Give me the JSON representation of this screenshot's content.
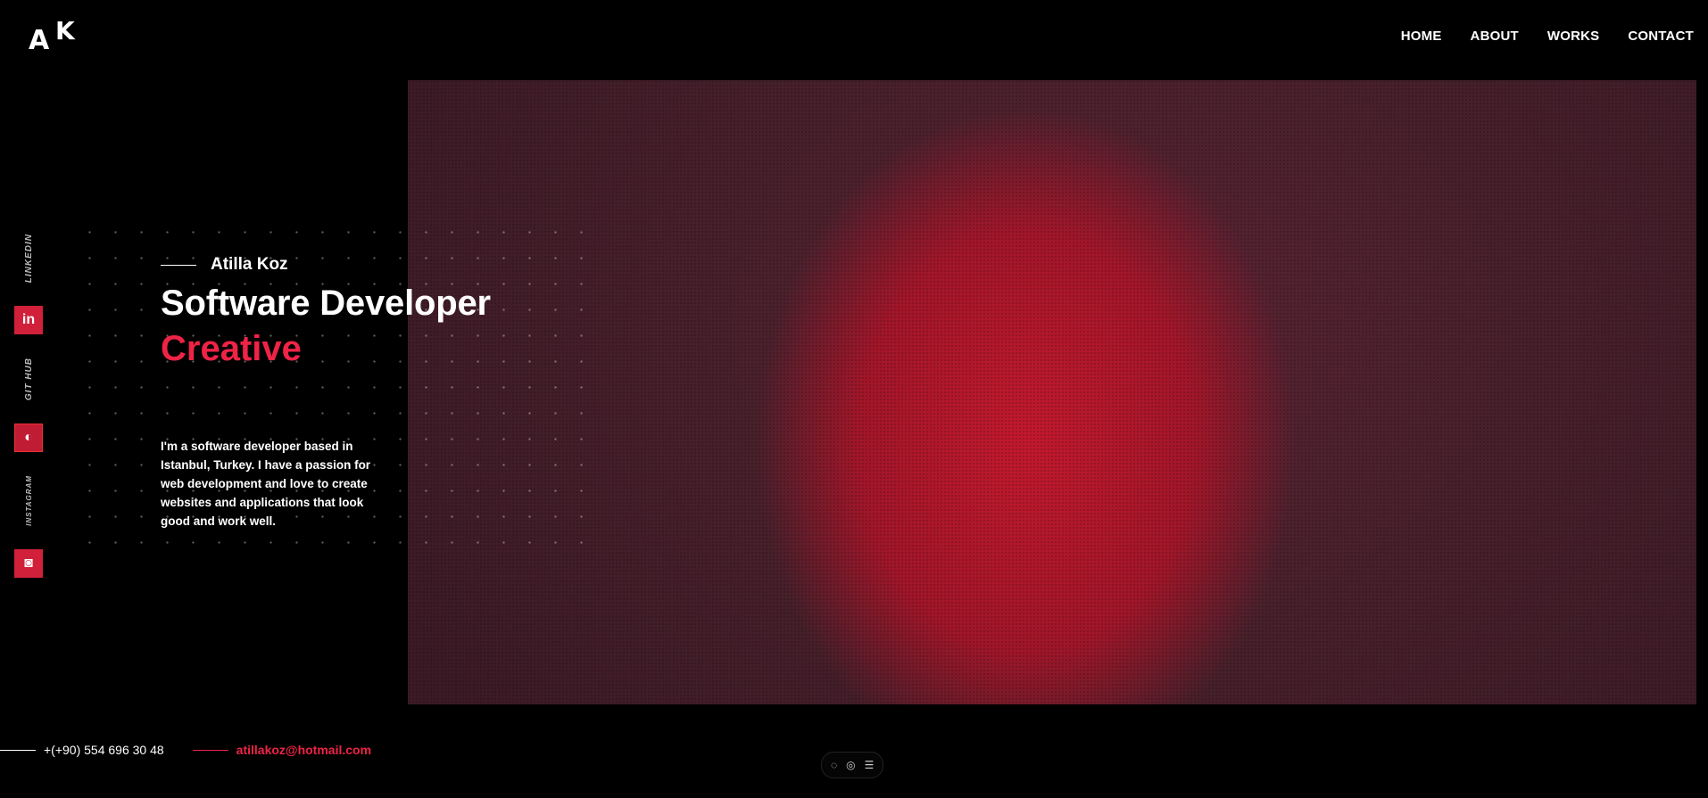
{
  "logo": {
    "letter_a": "A",
    "letter_k": "K"
  },
  "nav": {
    "items": [
      "HOME",
      "ABOUT",
      "WORKS",
      "CONTACT"
    ]
  },
  "intro": {
    "name": "Atilla Koz",
    "title": "Software Developer",
    "tagline": "Creative",
    "bio": "I'm a software developer based in Istanbul, Turkey. I have a passion for web development and love to create websites and applications that look good and work well."
  },
  "social": {
    "linkedin_label": "LINKEDIN",
    "github_label": "GIT HUB",
    "instagram_label": "INSTAGRAM",
    "linkedin_icon_glyph": "in",
    "github_icon_glyph": "◐",
    "instagram_icon_glyph": "◙"
  },
  "contact": {
    "phone": "+(+90) 554 696 30 48",
    "email": "atillakoz@hotmail.com"
  },
  "toolbar": {
    "icons": [
      "chat-icon",
      "eye-icon",
      "menu-icon"
    ],
    "glyphs": [
      "◌",
      "◎",
      "☰"
    ]
  },
  "colors": {
    "accent": "#ee2346",
    "background": "#000000"
  }
}
